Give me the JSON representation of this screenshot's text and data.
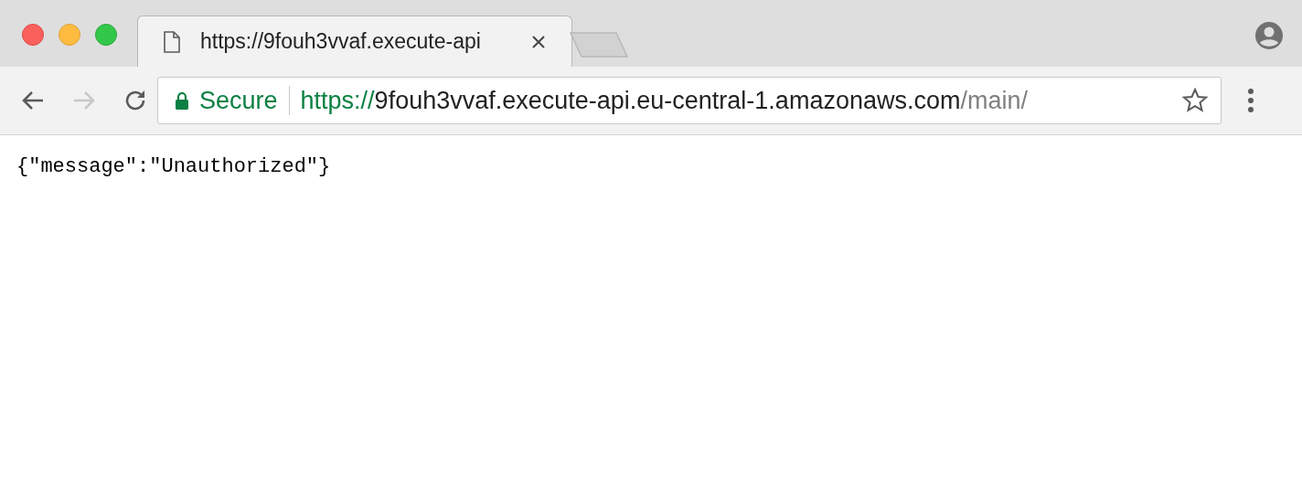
{
  "tabs": [
    {
      "title": "https://9fouh3vvaf.execute-api",
      "selected": true
    }
  ],
  "toolbar": {
    "back": {
      "disabled": false
    },
    "forward": {
      "disabled": true
    }
  },
  "address_bar": {
    "security_label": "Secure",
    "scheme": "https://",
    "host": "9fouh3vvaf.execute-api.eu-central-1.amazonaws.com",
    "path": "/main/"
  },
  "page": {
    "body_text": "{\"message\":\"Unauthorized\"}"
  }
}
